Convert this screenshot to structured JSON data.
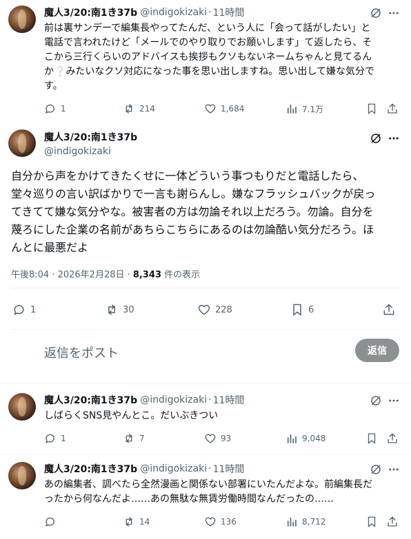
{
  "author": {
    "name": "魔人3/20:南1き37b",
    "handle": "@indigokizaki"
  },
  "tweet1": {
    "name": "魔人3/20:南1き37b",
    "handle": "@indigokizaki",
    "time": "11時間",
    "text": "前は裏サンデーで編集長やってたんだ、という人に「会って話がしたい」と\n電話で言われたけど「メールでのやり取りでお願いします」て返したら、そ\nこから三行くらいのアドバイスも挨拶もクソもないネームちゃんと見てるん\nか❔みたいなクソ対応になった事を思い出しますね。思い出して嫌な気分で\nす。",
    "replies": "1",
    "retweets": "214",
    "likes": "1,684",
    "views": "7.1万"
  },
  "main": {
    "name": "魔人3/20:南1き37b",
    "handle": "@indigokizaki",
    "text": "自分から声をかけてきたくせに一体どういう事つもりだと電話したら、\n堂々巡りの言い訳ばかりで一言も謝らんし。嫌なフラッシュバックが戻っ\nてきてて嫌な気分やな。被害者の方は勿論それ以上だろう。勿論。自分を\n蔑ろにした企業の名前があちらこちらにあるのは勿論酷い気分だろう。ほ\nんとに最悪だよ",
    "timestamp": "午後8:04 · 2026年2月28日 · ",
    "views_count": "8,343",
    "views_label": " 件の表示",
    "replies": "1",
    "retweets": "30",
    "likes": "228",
    "bookmarks": "6",
    "reply_placeholder": "返信をポスト",
    "reply_button": "返信"
  },
  "tweet3": {
    "name": "魔人3/20:南1き37b",
    "handle": "@indigokizaki",
    "time": "11時間",
    "text": "しばらくSNS見やんとこ。だいぶきつい",
    "replies": "1",
    "retweets": "7",
    "likes": "93",
    "views": "9,048"
  },
  "tweet4": {
    "name": "魔人3/20:南1き37b",
    "handle": "@indigokizaki",
    "time": "11時間",
    "text": "あの編集者、調べたら全然漫画と関係ない部署にいたんだよな。前編集長だ\nったから何なんだよ……あの無駄な無賃労働時間なんだったの……",
    "replies": "",
    "retweets": "14",
    "likes": "136",
    "views": "8,712"
  },
  "colors": {
    "text": "#0f1419",
    "secondary": "#536471",
    "divider": "#eff3f4",
    "reply_button_bg": "#8b9193"
  }
}
